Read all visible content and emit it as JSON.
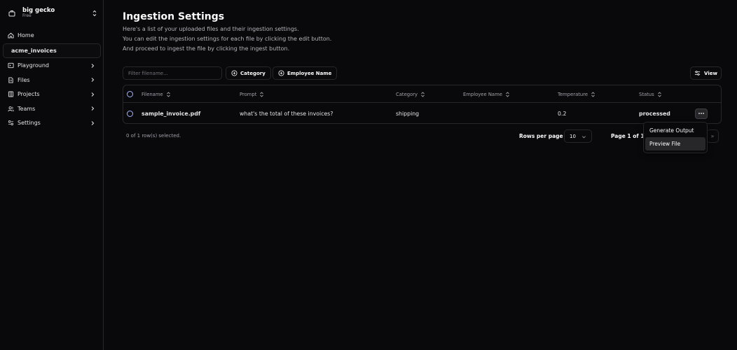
{
  "org": {
    "name": "big gecko",
    "plan": "Free",
    "icon": "briefcase-icon"
  },
  "nav": [
    {
      "label": "Home",
      "icon": "home-icon",
      "has_chevron": false
    },
    {
      "label": "acme_invoices",
      "icon": "",
      "has_chevron": false,
      "active": true
    },
    {
      "label": "Playground",
      "icon": "terminal-icon",
      "has_chevron": true
    },
    {
      "label": "Files",
      "icon": "files-icon",
      "has_chevron": true
    },
    {
      "label": "Projects",
      "icon": "projects-icon",
      "has_chevron": true
    },
    {
      "label": "Teams",
      "icon": "users-icon",
      "has_chevron": true
    },
    {
      "label": "Settings",
      "icon": "settings-icon",
      "has_chevron": true
    }
  ],
  "page": {
    "title": "Ingestion Settings",
    "desc1": "Here's a list of your uploaded files and their ingestion settings.",
    "desc2": "You can edit the ingestion settings for each file by clicking the edit button.",
    "desc3": "And proceed to ingest the file by clicking the ingest button."
  },
  "toolbar": {
    "filter_placeholder": "Filter filename...",
    "category_chip": "Category",
    "employee_chip": "Employee Name",
    "view_label": "View"
  },
  "table": {
    "headers": {
      "filename": "Filename",
      "prompt": "Prompt",
      "category": "Category",
      "employee_name": "Employee Name",
      "temperature": "Temperature",
      "status": "Status"
    },
    "rows": [
      {
        "filename": "sample_invoice.pdf",
        "prompt": "what's the total of these invoices?",
        "category": "shipping",
        "employee_name": "",
        "temperature": "0.2",
        "status": "processed"
      }
    ]
  },
  "footer": {
    "selected": "0 of 1 row(s) selected.",
    "rows_per_page_label": "Rows per page",
    "rows_per_page_value": "10",
    "page_label": "Page 1 of 1",
    "next_last": "»"
  },
  "row_menu": {
    "items": [
      "Generate Output",
      "Preview File"
    ]
  },
  "colors": {
    "background": "#09090b",
    "border": "#27272a",
    "checkbox": "#a5b4fc"
  }
}
